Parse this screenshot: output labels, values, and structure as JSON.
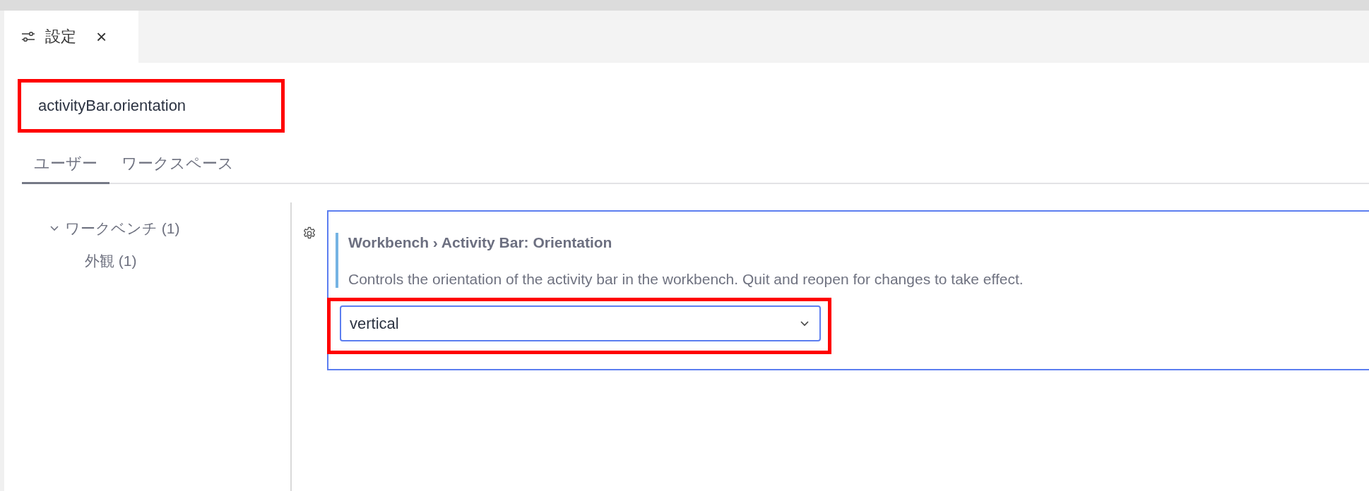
{
  "editor_tab": {
    "label": "設定",
    "close": "×"
  },
  "search": {
    "value": "activityBar.orientation"
  },
  "scope_tabs": [
    {
      "label": "ユーザー",
      "selected": true
    },
    {
      "label": "ワークスペース",
      "selected": false
    }
  ],
  "tree": [
    {
      "label": "ワークベンチ (1)",
      "expanded": true,
      "children": [
        {
          "label": "外観 (1)"
        }
      ]
    }
  ],
  "setting": {
    "title": "Workbench › Activity Bar: Orientation",
    "description": "Controls the orientation of the activity bar in the workbench. Quit and reopen for changes to take effect.",
    "value": "vertical"
  }
}
